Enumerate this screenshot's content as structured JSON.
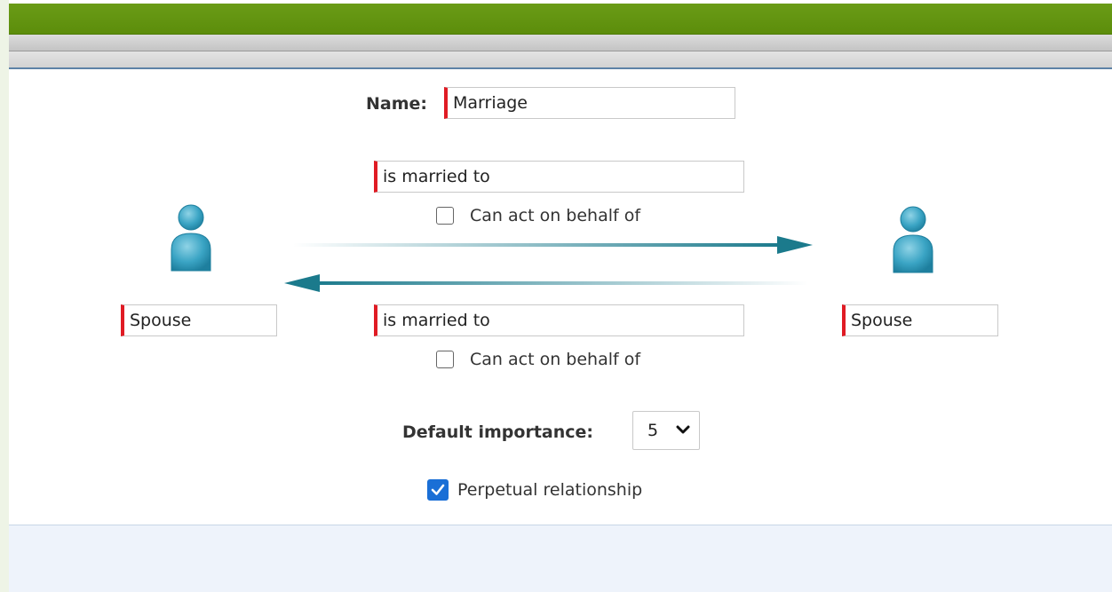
{
  "form": {
    "name_label": "Name:",
    "name_value": "Marriage",
    "forward_relation": "is married to",
    "forward_can_act_label": "Can act on behalf of",
    "forward_can_act_checked": false,
    "reverse_relation": "is married to",
    "reverse_can_act_label": "Can act on behalf of",
    "reverse_can_act_checked": false,
    "left_role": "Spouse",
    "right_role": "Spouse",
    "importance_label": "Default importance:",
    "importance_value": "5",
    "perpetual_label": "Perpetual relationship",
    "perpetual_checked": true
  },
  "icons": {
    "left_person": "person-icon",
    "right_person": "person-icon",
    "forward_arrow": "arrow-right-icon",
    "reverse_arrow": "arrow-left-icon",
    "select_chevron": "chevron-down-icon"
  },
  "colors": {
    "header_green": "#5c8d0b",
    "required_marker": "#e01b24",
    "arrow_teal": "#1b7a8c",
    "checkbox_blue": "#1a6fd6"
  }
}
